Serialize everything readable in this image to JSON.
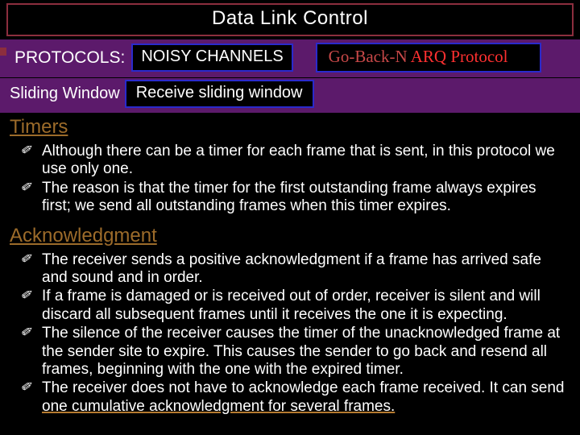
{
  "title": "Data Link Control",
  "row1": {
    "protocols_label": "PROTOCOLS:",
    "noisy": "NOISY CHANNELS",
    "goback_prefix": "Go-Back-N ",
    "goback_suffix": "ARQ Protocol"
  },
  "row2": {
    "sw_label": "Sliding Window",
    "recv": "Receive sliding window"
  },
  "timers": {
    "heading": "Timers",
    "items": [
      "Although there can be a timer for each frame that is sent, in this protocol we use only one.",
      "The reason is that the timer for the first outstanding frame always expires first; we send all outstanding frames when this timer expires."
    ]
  },
  "ack": {
    "heading": "Acknowledgment",
    "items": [
      "The receiver sends a positive acknowledgment if a frame has arrived safe and sound and in order.",
      "If a frame is damaged or is received out of order, receiver is silent and will discard all subsequent frames until it receives the one it is expecting.",
      "The silence of the receiver causes the timer of the unacknowledged frame at the sender site to expire. This causes the sender to go back and resend all frames, beginning with the one with the expired timer.",
      "The receiver does not have to acknowledge each frame received. It can send "
    ],
    "last_underlined": "one cumulative acknowledgment for several frames."
  }
}
